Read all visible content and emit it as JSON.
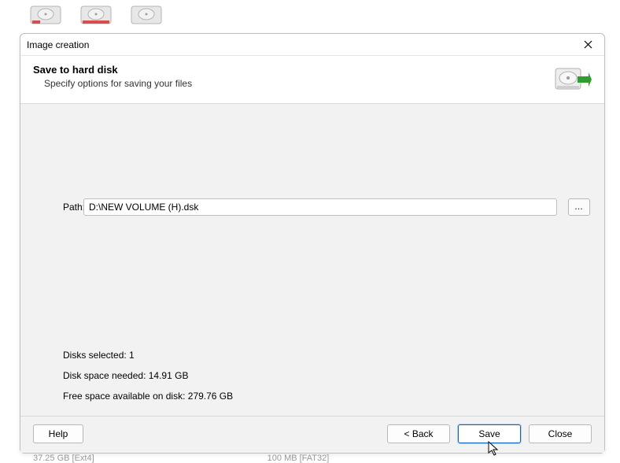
{
  "dialog": {
    "title": "Image creation",
    "heading": "Save to hard disk",
    "subheading": "Specify options for saving your files"
  },
  "form": {
    "path_label": "Path:",
    "path_value": "D:\\NEW VOLUME (H).dsk",
    "browse_label": "..."
  },
  "info": {
    "disks_selected_label": "Disks selected:",
    "disks_selected_value": "1",
    "space_needed_label": "Disk space needed:",
    "space_needed_value": "14.91 GB",
    "free_space_label": "Free space available on disk:",
    "free_space_value": "279.76 GB"
  },
  "buttons": {
    "help": "Help",
    "back": "< Back",
    "save": "Save",
    "close": "Close"
  },
  "background": {
    "row_left": "37.25 GB [Ext4]",
    "row_right": "100 MB [FAT32]"
  }
}
